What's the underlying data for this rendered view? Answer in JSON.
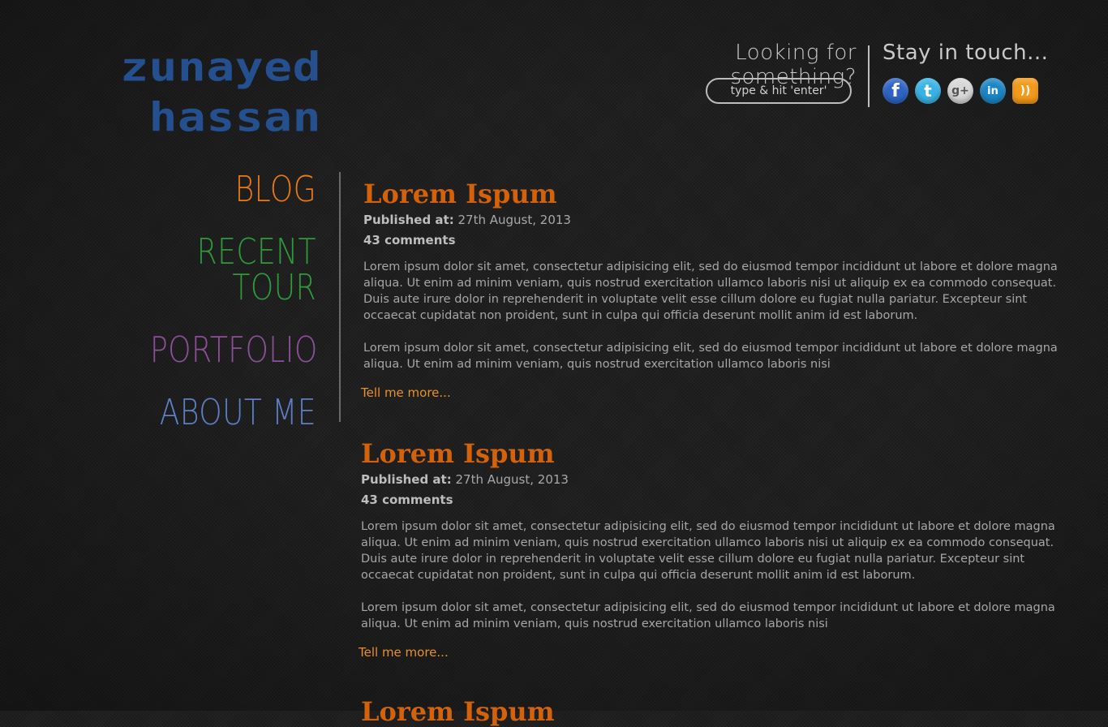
{
  "logo": {
    "line1": "zunayed",
    "line2": "hassan",
    "color": "#25508f"
  },
  "search": {
    "heading": "Looking for something?",
    "placeholder": "type & hit 'enter'"
  },
  "social": {
    "heading": "Stay in touch...",
    "icons": [
      {
        "name": "facebook-icon",
        "glyph": "f"
      },
      {
        "name": "twitter-icon",
        "glyph": "t"
      },
      {
        "name": "google-plus-icon",
        "glyph": "g+"
      },
      {
        "name": "linkedin-icon",
        "glyph": "in"
      },
      {
        "name": "rss-icon",
        "glyph": "))"
      }
    ]
  },
  "nav": {
    "items": [
      {
        "label": "BLOG",
        "color": "#e87a16"
      },
      {
        "label": "RECENT TOUR",
        "color": "#2e9a3a"
      },
      {
        "label": "PORTFOLIO",
        "color": "#8e4f9a"
      },
      {
        "label": "ABOUT ME",
        "color": "#5d7fc4"
      }
    ]
  },
  "posts": [
    {
      "title": "Lorem Ispum",
      "published_label": "Published at:",
      "published_date": "27th August, 2013",
      "comments": "43 comments",
      "paragraph1": "Lorem ipsum dolor sit amet, consectetur adipisicing elit, sed do eiusmod tempor incididunt ut labore et dolore magna aliqua. Ut enim ad minim veniam, quis nostrud exercitation ullamco laboris nisi ut aliquip ex ea commodo consequat. Duis aute irure dolor in reprehenderit in voluptate velit esse cillum dolore eu fugiat nulla pariatur. Excepteur sint occaecat cupidatat non proident, sunt in culpa qui officia deserunt mollit anim id est laborum.",
      "paragraph2": "Lorem ipsum dolor sit amet, consectetur adipisicing elit, sed do eiusmod tempor incididunt ut labore et dolore magna aliqua. Ut enim ad minim veniam, quis nostrud exercitation ullamco laboris nisi",
      "more": "Tell me more..."
    },
    {
      "title": "Lorem Ispum",
      "published_label": "Published at:",
      "published_date": "27th August, 2013",
      "comments": "43 comments",
      "paragraph1": "Lorem ipsum dolor sit amet, consectetur adipisicing elit, sed do eiusmod tempor incididunt ut labore et dolore magna aliqua. Ut enim ad minim veniam, quis nostrud exercitation ullamco laboris nisi ut aliquip ex ea commodo consequat. Duis aute irure dolor in reprehenderit in voluptate velit esse cillum dolore eu fugiat nulla pariatur. Excepteur sint occaecat cupidatat non proident, sunt in culpa qui officia deserunt mollit anim id est laborum.",
      "paragraph2": "Lorem ipsum dolor sit amet, consectetur adipisicing elit, sed do eiusmod tempor incididunt ut labore et dolore magna aliqua. Ut enim ad minim veniam, quis nostrud exercitation ullamco laboris nisi",
      "more": "Tell me more..."
    },
    {
      "title": "Lorem Ispum"
    }
  ],
  "colors": {
    "accent_orange": "#d3620b",
    "link_orange": "#e8912a"
  }
}
